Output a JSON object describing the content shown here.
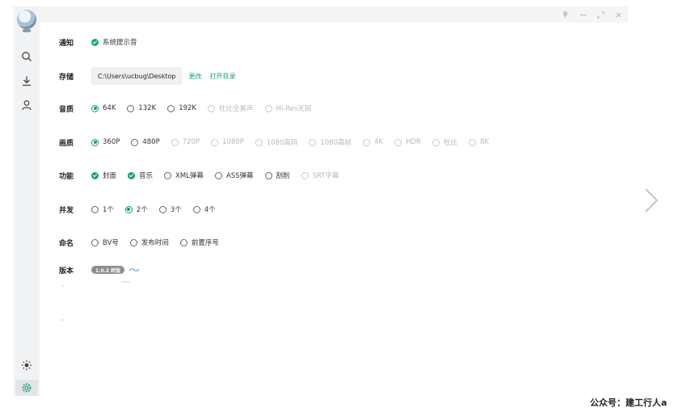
{
  "window": {
    "controls": [
      "pin",
      "minimize",
      "maximize",
      "close"
    ]
  },
  "sidebar": {
    "items": [
      {
        "name": "search-icon"
      },
      {
        "name": "download-icon"
      },
      {
        "name": "user-icon"
      }
    ],
    "bottom": [
      {
        "name": "theme-sun-icon"
      },
      {
        "name": "settings-gear-icon",
        "active": true
      }
    ]
  },
  "settings": {
    "notify": {
      "label": "通知",
      "options": [
        {
          "text": "系统提示音",
          "checked": true
        }
      ]
    },
    "storage": {
      "label": "存储",
      "path": "C:\\Users\\ucbug\\Desktop",
      "change": "更改",
      "open_dir": "打开目录"
    },
    "audio": {
      "label": "音质",
      "options": [
        {
          "text": "64K",
          "checked": true
        },
        {
          "text": "132K"
        },
        {
          "text": "192K"
        },
        {
          "text": "杜比全景声",
          "disabled": true
        },
        {
          "text": "Hi-Res无损",
          "disabled": true
        }
      ]
    },
    "video": {
      "label": "画质",
      "options": [
        {
          "text": "360P",
          "checked": true
        },
        {
          "text": "480P"
        },
        {
          "text": "720P",
          "disabled": true
        },
        {
          "text": "1080P",
          "disabled": true
        },
        {
          "text": "1080高码",
          "disabled": true
        },
        {
          "text": "1080高帧",
          "disabled": true
        },
        {
          "text": "4K",
          "disabled": true
        },
        {
          "text": "HDR",
          "disabled": true
        },
        {
          "text": "杜比",
          "disabled": true
        },
        {
          "text": "8K",
          "disabled": true
        }
      ]
    },
    "features": {
      "label": "功能",
      "options": [
        {
          "text": "封面",
          "checked": true,
          "type": "check"
        },
        {
          "text": "音乐",
          "checked": true,
          "type": "check"
        },
        {
          "text": "XML弹幕"
        },
        {
          "text": "ASS弹幕"
        },
        {
          "text": "刮削"
        },
        {
          "text": "SRT字幕",
          "disabled": true
        }
      ]
    },
    "concurrency": {
      "label": "并发",
      "options": [
        {
          "text": "1个"
        },
        {
          "text": "2个",
          "checked": true
        },
        {
          "text": "3个"
        },
        {
          "text": "4个"
        }
      ]
    },
    "naming": {
      "label": "命名",
      "options": [
        {
          "text": "BV号"
        },
        {
          "text": "发布时间"
        },
        {
          "text": "前置序号"
        }
      ]
    },
    "version": {
      "label": "版本",
      "badge": "1.0.2 终版"
    }
  },
  "watermark": "公众号：建工行人a",
  "colors": {
    "accent": "#1aa574",
    "sidebar": "#f1f2f4"
  }
}
